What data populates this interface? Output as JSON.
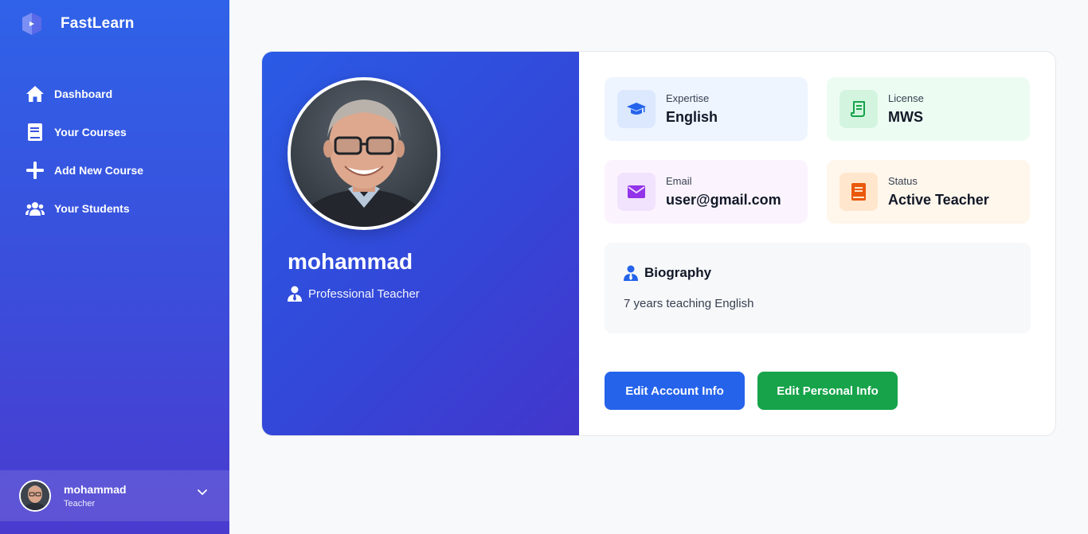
{
  "app": {
    "name": "FastLearn"
  },
  "sidebar": {
    "items": [
      {
        "label": "Dashboard",
        "icon": "home-icon"
      },
      {
        "label": "Your Courses",
        "icon": "book-icon"
      },
      {
        "label": "Add New Course",
        "icon": "plus-icon"
      },
      {
        "label": "Your Students",
        "icon": "users-icon"
      }
    ],
    "user": {
      "name": "mohammad",
      "role": "Teacher"
    }
  },
  "profile": {
    "name": "mohammad",
    "title": "Professional Teacher",
    "tiles": [
      {
        "label": "Expertise",
        "value": "English",
        "icon": "graduation-cap-icon",
        "bg": "#eef5ff",
        "icon_bg": "#dbe8fe",
        "icon_color": "#2563eb"
      },
      {
        "label": "License",
        "value": "MWS",
        "icon": "certificate-icon",
        "bg": "#edfcf2",
        "icon_bg": "#d3f5df",
        "icon_color": "#16a34a"
      },
      {
        "label": "Email",
        "value": "user@gmail.com",
        "icon": "envelope-icon",
        "bg": "#fbf4ff",
        "icon_bg": "#f1e2fd",
        "icon_color": "#9333ea"
      },
      {
        "label": "Status",
        "value": "Active Teacher",
        "icon": "book-status-icon",
        "bg": "#fff6ec",
        "icon_bg": "#ffe6cc",
        "icon_color": "#ea580c"
      }
    ],
    "biography": {
      "title": "Biography",
      "text": "7 years teaching English"
    }
  },
  "actions": {
    "edit_account": "Edit Account Info",
    "edit_personal": "Edit Personal Info"
  },
  "colors": {
    "accent": "#2563eb",
    "success": "#16a34a"
  }
}
